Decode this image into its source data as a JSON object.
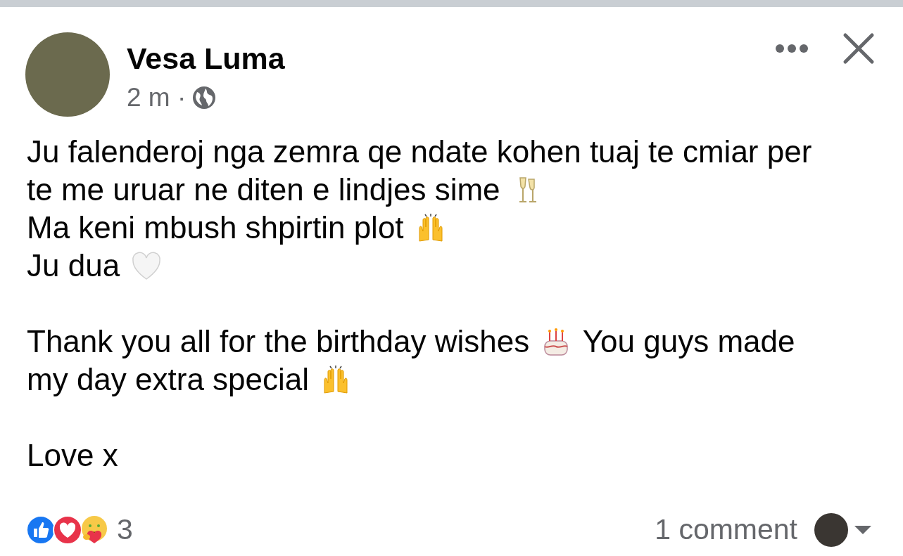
{
  "post": {
    "author": "Vesa Luma",
    "time": "2 m ·",
    "paragraphs": [
      {
        "lines": [
          [
            {
              "kind": "text",
              "text": "Ju falenderoj nga zemra qe ndate kohen tuaj te cmiar per"
            }
          ],
          [
            {
              "kind": "text",
              "text": "te me uruar ne diten e lindjes sime"
            },
            {
              "kind": "champagne"
            }
          ],
          [
            {
              "kind": "text",
              "text": "Ma keni mbush shpirtin plot"
            },
            {
              "kind": "hands"
            }
          ],
          [
            {
              "kind": "text",
              "text": "Ju dua"
            },
            {
              "kind": "heart"
            }
          ]
        ]
      },
      {
        "lines": [
          [
            {
              "kind": "text",
              "text": "Thank you all for the birthday wishes"
            },
            {
              "kind": "cake"
            },
            {
              "kind": "text",
              "text": "You guys made"
            }
          ],
          [
            {
              "kind": "text",
              "text": "my day extra special"
            },
            {
              "kind": "hands"
            }
          ]
        ]
      },
      {
        "lines": [
          [
            {
              "kind": "text",
              "text": "Love x"
            }
          ]
        ]
      }
    ]
  },
  "footer": {
    "reaction_count": "3",
    "comments": "1 comment"
  }
}
